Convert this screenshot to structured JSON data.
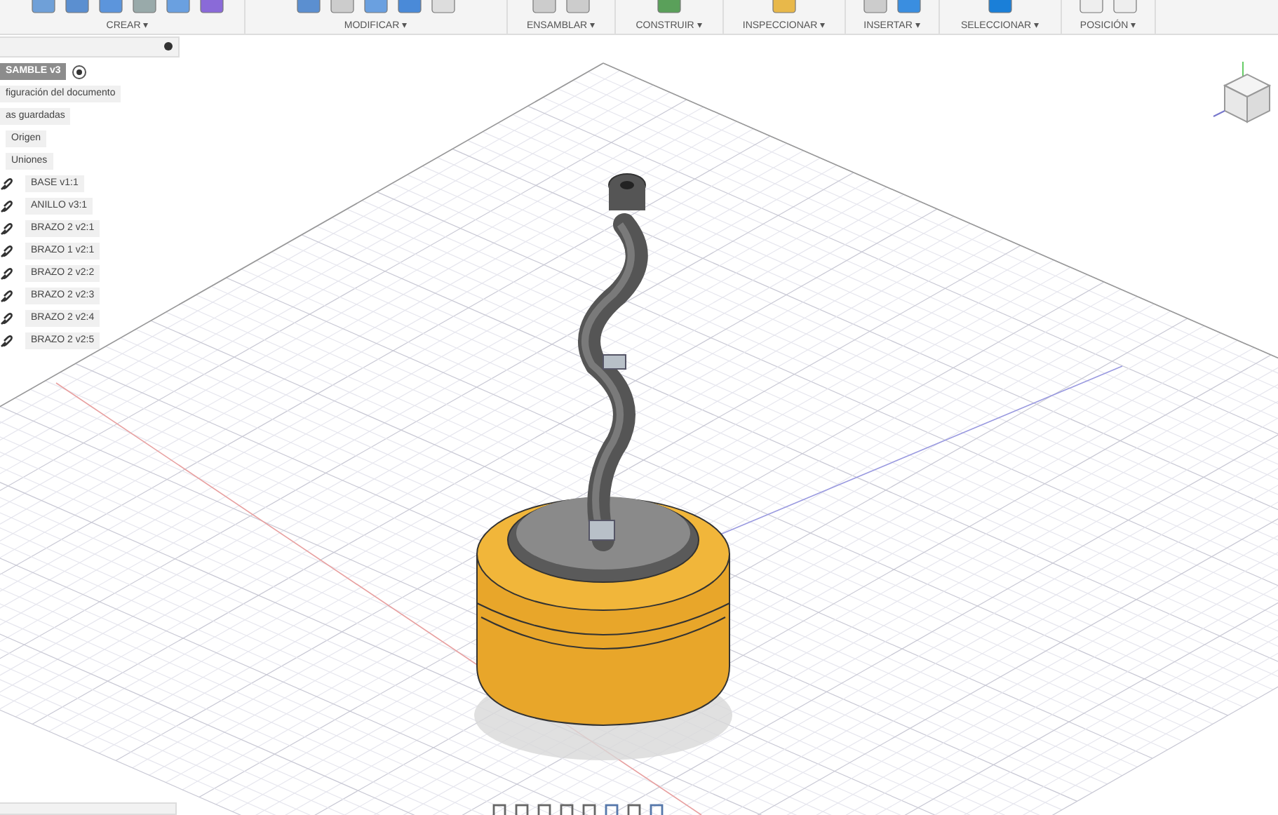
{
  "toolbar": {
    "groups": [
      {
        "label": "CREAR ▾"
      },
      {
        "label": "MODIFICAR ▾"
      },
      {
        "label": "ENSAMBLAR ▾"
      },
      {
        "label": "CONSTRUIR ▾"
      },
      {
        "label": "INSPECCIONAR ▾"
      },
      {
        "label": "INSERTAR ▾"
      },
      {
        "label": "SELECCIONAR ▾"
      },
      {
        "label": "POSICIÓN ▾"
      }
    ]
  },
  "browser": {
    "items": [
      {
        "kind": "root",
        "label": "SAMBLE v3",
        "selected": true
      },
      {
        "kind": "folder",
        "label": "figuración del documento",
        "selected": false
      },
      {
        "kind": "folder",
        "label": "as guardadas",
        "selected": false
      },
      {
        "kind": "folder",
        "label": "Origen",
        "selected": false
      },
      {
        "kind": "folder",
        "label": "Uniones",
        "selected": false
      },
      {
        "kind": "component",
        "label": "BASE v1:1",
        "selected": false
      },
      {
        "kind": "component",
        "label": "ANILLO v3:1",
        "selected": false
      },
      {
        "kind": "component",
        "label": "BRAZO 2 v2:1",
        "selected": false
      },
      {
        "kind": "component",
        "label": "BRAZO 1 v2:1",
        "selected": false
      },
      {
        "kind": "component",
        "label": "BRAZO 2 v2:2",
        "selected": false
      },
      {
        "kind": "component",
        "label": "BRAZO 2 v2:3",
        "selected": false
      },
      {
        "kind": "component",
        "label": "BRAZO 2 v2:4",
        "selected": false
      },
      {
        "kind": "component",
        "label": "BRAZO 2 v2:5",
        "selected": false
      }
    ]
  }
}
